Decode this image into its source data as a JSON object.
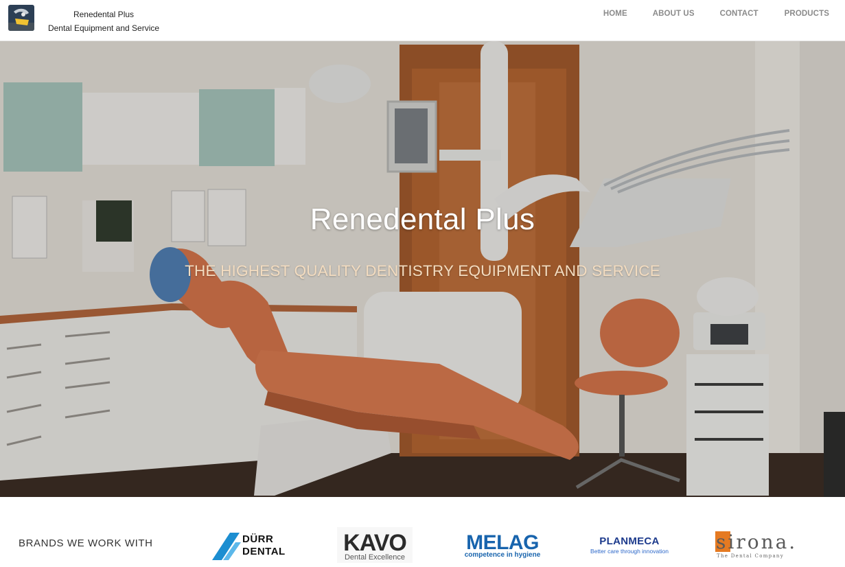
{
  "header": {
    "site_name": "Renedental Plus",
    "tagline": "Dental Equipment and Service",
    "nav": [
      {
        "label": "HOME"
      },
      {
        "label": "ABOUT US"
      },
      {
        "label": "CONTACT"
      },
      {
        "label": "PRODUCTS"
      }
    ]
  },
  "hero": {
    "title": "Renedental Plus",
    "subtitle": "THE HIGHEST QUALITY DENTISTRY EQUIPMENT AND SERVICE"
  },
  "brands": {
    "label": "BRANDS WE WORK WITH",
    "logos": [
      {
        "name": "DÜRR",
        "name2": "DENTAL"
      },
      {
        "name": "KAVO",
        "sub": "Dental Excellence"
      },
      {
        "name": "MELAG",
        "sub": "competence in hygiene"
      },
      {
        "name": "PLANMECA",
        "sub": "Better care through innovation"
      },
      {
        "name": "sirona.",
        "sub": "The Dental Company"
      }
    ]
  },
  "colors": {
    "nav_text": "#8a8a8a",
    "hero_subtitle": "#f3dcc0",
    "chair_orange": "#d9754a",
    "melag_blue": "#1864ad",
    "planmeca_blue": "#1c3a8c",
    "sirona_orange": "#e57a22"
  }
}
